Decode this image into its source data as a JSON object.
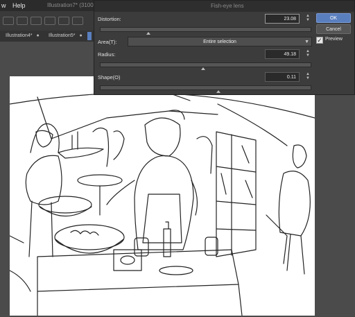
{
  "menubar": {
    "items": [
      {
        "label": "w"
      },
      {
        "label": "Help"
      }
    ],
    "app_title": "Illustration7* (3100"
  },
  "tabs": [
    {
      "label": "Illustration4*"
    },
    {
      "label": "Illustration5*"
    }
  ],
  "dialog": {
    "title": "Fish-eye lens",
    "distortion": {
      "label": "Distortion:",
      "value": "23.08"
    },
    "area": {
      "label": "Area(T):",
      "selected": "Entire selection"
    },
    "radius": {
      "label": "Radius:",
      "value": "49.18"
    },
    "shape": {
      "label": "Shape(O)",
      "value": "0.11"
    },
    "ok_label": "OK",
    "cancel_label": "Cancel",
    "preview_label": "Preview",
    "preview_checked": true,
    "slider_levels": {
      "distortion": 0.23,
      "radius": 0.49,
      "shape": 0.56
    }
  }
}
